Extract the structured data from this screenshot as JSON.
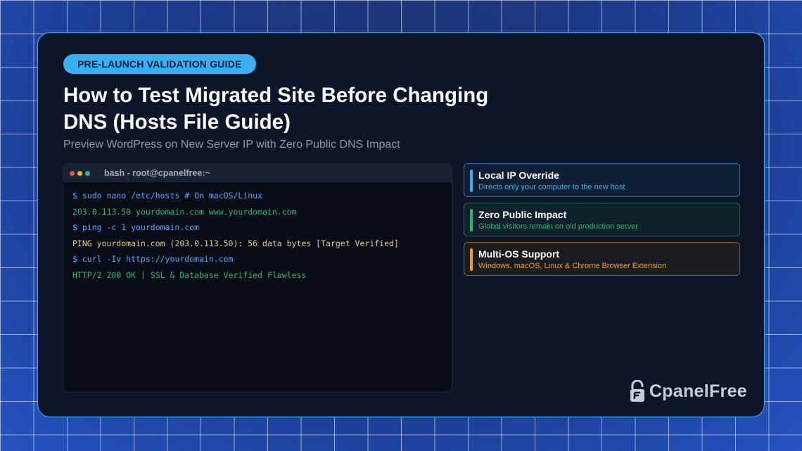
{
  "badge": "PRE-LAUNCH VALIDATION GUIDE",
  "title": "How to Test Migrated Site Before Changing DNS (Hosts File Guide)",
  "subtitle": "Preview WordPress on New Server IP with Zero Public DNS Impact",
  "terminal": {
    "title": "bash - root@cpanelfree:~",
    "lines": [
      {
        "text": "$ sudo nano /etc/hosts # On macOS/Linux",
        "color": "#58a6ff"
      },
      {
        "text": "203.0.113.50 yourdomain.com www.yourdomain.com",
        "color": "#2bb673"
      },
      {
        "text": "$ ping -c 1 yourdomain.com",
        "color": "#58a6ff"
      },
      {
        "text": "PING yourdomain.com (203.0.113.50): 56 data bytes [Target Verified]",
        "color": "#e8cf8f"
      },
      {
        "text": "$ curl -Iv https://yourdomain.com",
        "color": "#58a6ff"
      },
      {
        "text": "HTTP/2 200 OK | SSL & Database Verified Flawless",
        "color": "#2bb673"
      }
    ]
  },
  "features": [
    {
      "title": "Local IP Override",
      "desc": "Directs only your computer to the new host",
      "accent": "#3bb0f0",
      "desc_color": "#3bb0f0",
      "border": "#2e6fa8",
      "bg": "#0f2035"
    },
    {
      "title": "Zero Public Impact",
      "desc": "Global visitors remain on old production server",
      "accent": "#22b573",
      "desc_color": "#22b573",
      "border": "#1f6a57",
      "bg": "#0f2229"
    },
    {
      "title": "Multi-OS Support",
      "desc": "Windows, macOS, Linux & Chrome Browser Extension",
      "accent": "#f0a020",
      "desc_color": "#f0a020",
      "border": "#8a6024",
      "bg": "#1a1c1f"
    }
  ],
  "logo": {
    "text": "CpanelFree",
    "icon": "lock-icon"
  }
}
